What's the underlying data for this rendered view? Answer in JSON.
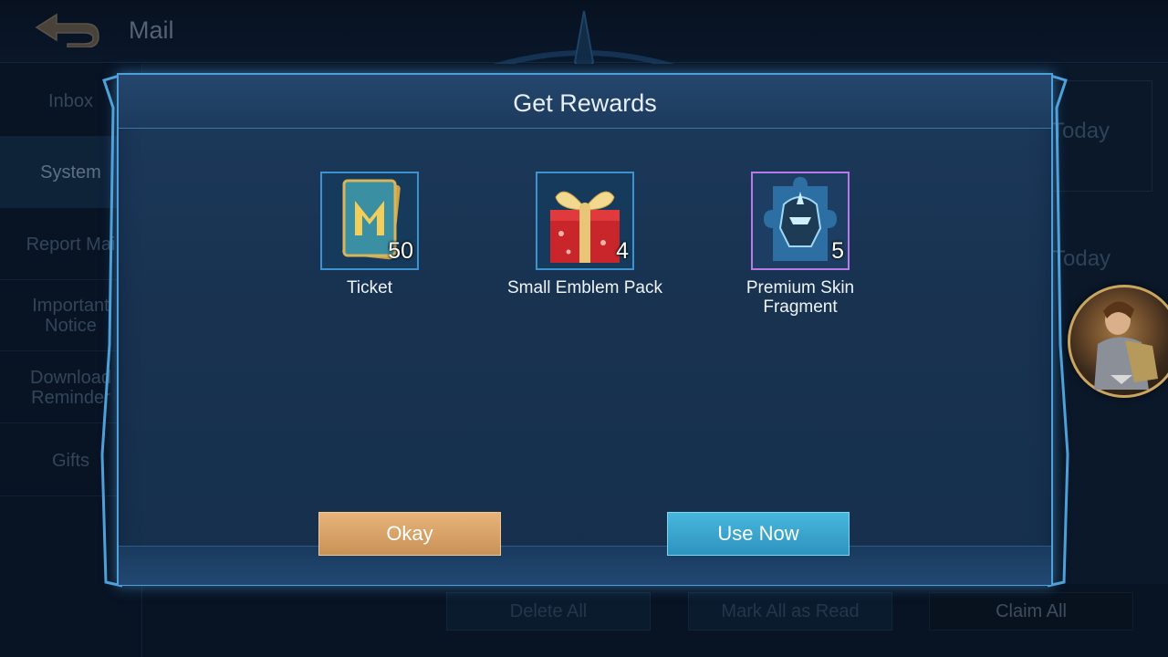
{
  "header": {
    "back_icon": "back-arrow-icon",
    "title": "Mail"
  },
  "sidebar": {
    "items": [
      {
        "label": "Inbox",
        "active": false
      },
      {
        "label": "System",
        "active": true
      },
      {
        "label": "Report Mai",
        "active": false
      },
      {
        "label": "Important Notice",
        "active": false
      },
      {
        "label": "Download Reminder",
        "active": false
      },
      {
        "label": "Gifts",
        "active": false
      }
    ]
  },
  "mail_list": {
    "dates": [
      "Today",
      "Today"
    ]
  },
  "bottom_bar": {
    "delete_all": "Delete All",
    "mark_all_read": "Mark All as Read",
    "claim_all": "Claim All"
  },
  "modal": {
    "title": "Get Rewards",
    "rewards": [
      {
        "name": "Ticket",
        "count": "50",
        "icon": "ticket-icon",
        "frame_color": "#3d93cf"
      },
      {
        "name": "Small Emblem Pack",
        "count": "4",
        "icon": "gift-box-icon",
        "frame_color": "#3d93cf"
      },
      {
        "name": "Premium Skin Fragment",
        "count": "5",
        "icon": "skin-fragment-icon",
        "frame_color": "#b77ae8"
      }
    ],
    "okay_label": "Okay",
    "use_now_label": "Use Now"
  },
  "colors": {
    "okay_button": "#d9a369",
    "use_now_button": "#3aa5cf",
    "modal_border": "#4fa0d8"
  }
}
